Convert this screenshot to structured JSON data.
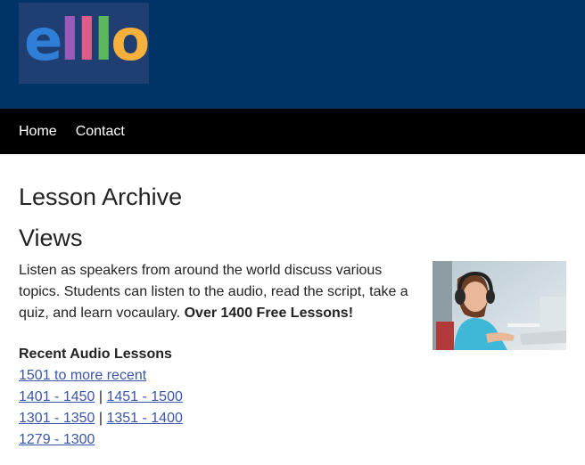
{
  "header": {
    "logo_letters": [
      {
        "char": "e",
        "color": "#2f7fd8"
      },
      {
        "char": "l",
        "color": "#9a5bb8"
      },
      {
        "char": "l",
        "color": "#e05a8a"
      },
      {
        "char": "l",
        "color": "#5cb85c"
      },
      {
        "char": "o",
        "color": "#f5b13c"
      }
    ],
    "background": "#003366"
  },
  "nav": {
    "items": [
      {
        "label": "Home"
      },
      {
        "label": "Contact"
      }
    ]
  },
  "main": {
    "title": "Lesson Archive",
    "section_title": "Views",
    "intro_text": "Listen as speakers from around the world discuss various topics. Students can listen to the audio, read the script, take a quiz, and learn vocaulary.",
    "intro_bold": "Over 1400 Free Lessons!",
    "recent_heading": "Recent Audio Lessons",
    "links": {
      "more_recent": "1501 to more recent",
      "r1401": "1401 - 1450",
      "r1451": "1451 - 1500",
      "r1301": "1301 - 1350",
      "r1351": "1351 - 1400",
      "r1279": "1279 - 1300"
    },
    "separator": "|"
  },
  "colors": {
    "link": "#3a55a8",
    "nav_bg": "#000000"
  }
}
